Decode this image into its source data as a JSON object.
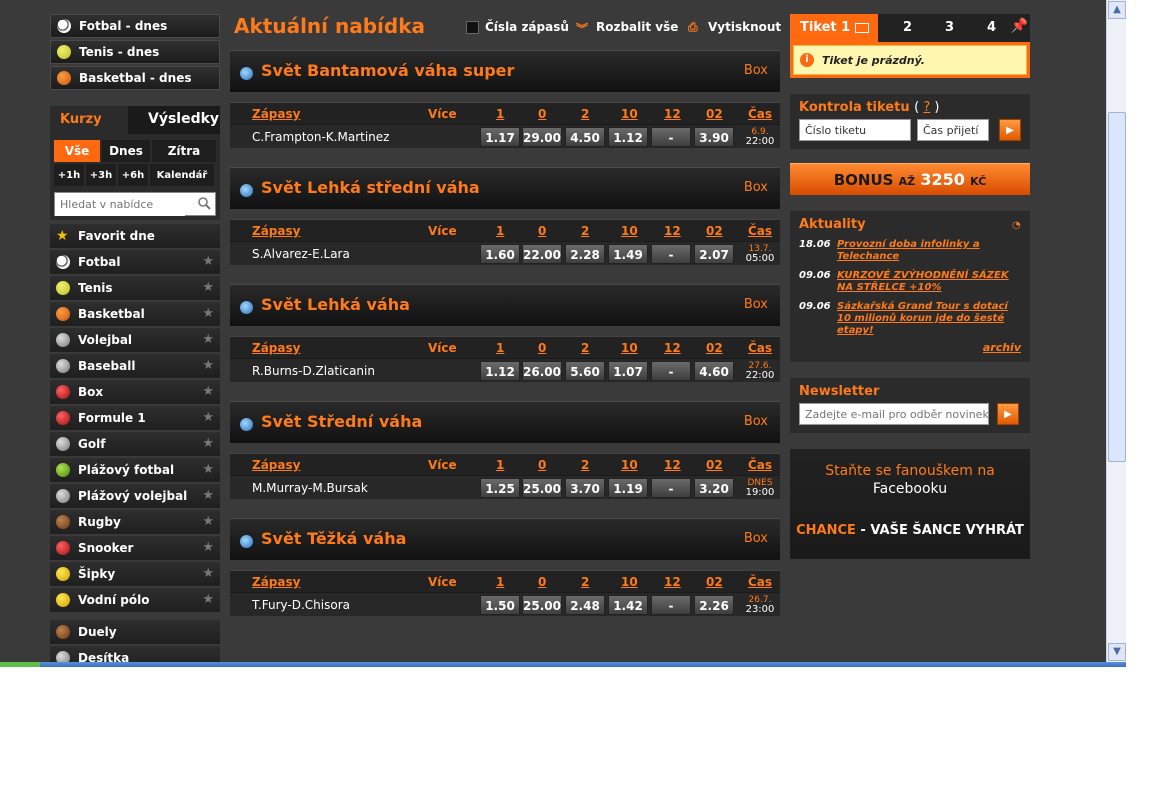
{
  "left": {
    "quick": [
      {
        "label": "Fotbal - dnes",
        "icon": "soccer-ball-icon"
      },
      {
        "label": "Tenis - dnes",
        "icon": "tennis-ball-icon"
      },
      {
        "label": "Basketbal - dnes",
        "icon": "basketball-icon"
      }
    ],
    "tabs": {
      "odds": "Kurzy",
      "results": "Výsledky"
    },
    "days": [
      "Vše",
      "Dnes",
      "Zítra"
    ],
    "hours": [
      "+1h",
      "+3h",
      "+6h",
      "Kalendář"
    ],
    "search_placeholder": "Hledat v nabídce",
    "sports": [
      {
        "label": "Favorit dne",
        "icon": "star-icon"
      },
      {
        "label": "Fotbal",
        "icon": "soccer-ball-icon"
      },
      {
        "label": "Tenis",
        "icon": "tennis-ball-icon"
      },
      {
        "label": "Basketbal",
        "icon": "basketball-icon"
      },
      {
        "label": "Volejbal",
        "icon": "volleyball-icon"
      },
      {
        "label": "Baseball",
        "icon": "baseball-icon"
      },
      {
        "label": "Box",
        "icon": "boxing-glove-icon"
      },
      {
        "label": "Formule 1",
        "icon": "race-car-icon"
      },
      {
        "label": "Golf",
        "icon": "golf-icon"
      },
      {
        "label": "Plážový fotbal",
        "icon": "beach-soccer-icon"
      },
      {
        "label": "Plážový volejbal",
        "icon": "beach-volleyball-icon"
      },
      {
        "label": "Rugby",
        "icon": "rugby-ball-icon"
      },
      {
        "label": "Snooker",
        "icon": "snooker-icon"
      },
      {
        "label": "Šipky",
        "icon": "darts-icon"
      },
      {
        "label": "Vodní pólo",
        "icon": "water-polo-icon"
      }
    ],
    "extras": [
      {
        "label": "Duely",
        "icon": "scales-icon"
      },
      {
        "label": "Desítka",
        "icon": "ten-icon"
      }
    ]
  },
  "center": {
    "title": "Aktuální nabídka",
    "options": {
      "numbers": "Čísla zápasů",
      "expand": "Rozbalit vše",
      "print": "Vytisknout"
    },
    "columns": {
      "matches": "Zápasy",
      "more": "Více",
      "c1": "1",
      "c0": "0",
      "c2": "2",
      "c10": "10",
      "c12": "12",
      "c02": "02",
      "time": "Čas"
    },
    "events": [
      {
        "title": "Svět Bantamová váha super",
        "sport": "Box",
        "match": "C.Frampton-K.Martinez",
        "odds": [
          "1.17",
          "29.00",
          "4.50",
          "1.12",
          "-",
          "3.90"
        ],
        "date": "6.9.",
        "time": "22:00"
      },
      {
        "title": "Svět Lehká střední váha",
        "sport": "Box",
        "match": "S.Alvarez-E.Lara",
        "odds": [
          "1.60",
          "22.00",
          "2.28",
          "1.49",
          "-",
          "2.07"
        ],
        "date": "13.7.",
        "time": "05:00"
      },
      {
        "title": "Svět Lehká váha",
        "sport": "Box",
        "match": "R.Burns-D.Zlaticanin",
        "odds": [
          "1.12",
          "26.00",
          "5.60",
          "1.07",
          "-",
          "4.60"
        ],
        "date": "27.6.",
        "time": "22:00"
      },
      {
        "title": "Svět Střední váha",
        "sport": "Box",
        "match": "M.Murray-M.Bursak",
        "odds": [
          "1.25",
          "25.00",
          "3.70",
          "1.19",
          "-",
          "3.20"
        ],
        "date": "DNES",
        "time": "19:00"
      },
      {
        "title": "Svět Těžká váha",
        "sport": "Box",
        "match": "T.Fury-D.Chisora",
        "odds": [
          "1.50",
          "25.00",
          "2.48",
          "1.42",
          "-",
          "2.26"
        ],
        "date": "26.7.",
        "time": "23:00"
      }
    ]
  },
  "right": {
    "ticket": {
      "tab_active": "Tiket 1",
      "tabs": [
        "2",
        "3",
        "4"
      ],
      "empty": "Tiket je prázdný."
    },
    "check": {
      "title": "Kontrola tiketu",
      "help": "?",
      "number_value": "Číslo tiketu",
      "time_value": "Čas přijetí"
    },
    "bonus": {
      "text": "BONUS",
      "az": "AŽ",
      "amount": "3250",
      "currency": "KČ"
    },
    "news": {
      "title": "Aktuality",
      "items": [
        {
          "date": "18.06",
          "text": "Provozní doba infolinky a Telechance"
        },
        {
          "date": "09.06",
          "text": "KURZOVÉ ZVÝHODNĚNÍ SÁZEK NA STŘELCE +10%"
        },
        {
          "date": "09.06",
          "text": "Sázkařská Grand Tour s dotací 10 milionů korun jde do šesté etapy!"
        }
      ],
      "archive": "archiv"
    },
    "newsletter": {
      "title": "Newsletter",
      "placeholder": "Zadejte e-mail pro odběr novinek"
    },
    "facebook": {
      "line1": "Staňte se fanouškem na",
      "line2": "Facebooku",
      "brand": "CHANCE",
      "slogan": " - VAŠE ŠANCE VYHRÁT"
    }
  },
  "colors": {
    "accent": "#ff7a1a",
    "background": "#3a3a3a"
  }
}
